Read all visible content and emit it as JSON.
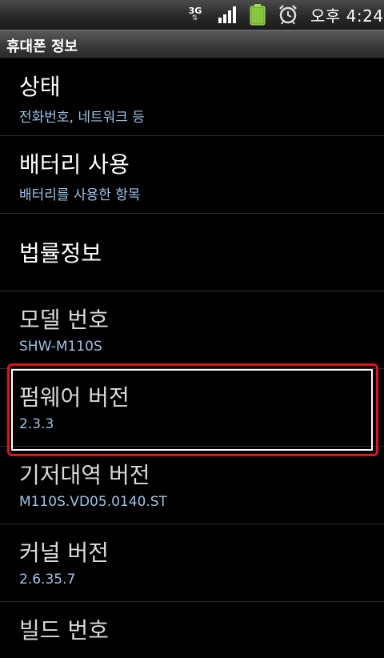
{
  "status_bar": {
    "network": "3G",
    "time": "오후 4:24"
  },
  "title_bar": {
    "title": "휴대폰 정보"
  },
  "items": [
    {
      "title": "상태",
      "summary": "전화번호, 네트워크 등"
    },
    {
      "title": "배터리 사용",
      "summary": "배터리를 사용한 항목"
    },
    {
      "title": "법률정보"
    },
    {
      "title": "모델 번호",
      "summary": "SHW-M110S"
    },
    {
      "title": "펌웨어 버전",
      "summary": "2.3.3"
    },
    {
      "title": "기저대역 버전",
      "summary": "M110S.VD05.0140.ST"
    },
    {
      "title": "커널 버전",
      "summary": "2.6.35.7"
    },
    {
      "title": "빌드 번호"
    }
  ],
  "colors": {
    "highlight": "#e0141e",
    "summary_text": "#9cc3e8"
  }
}
